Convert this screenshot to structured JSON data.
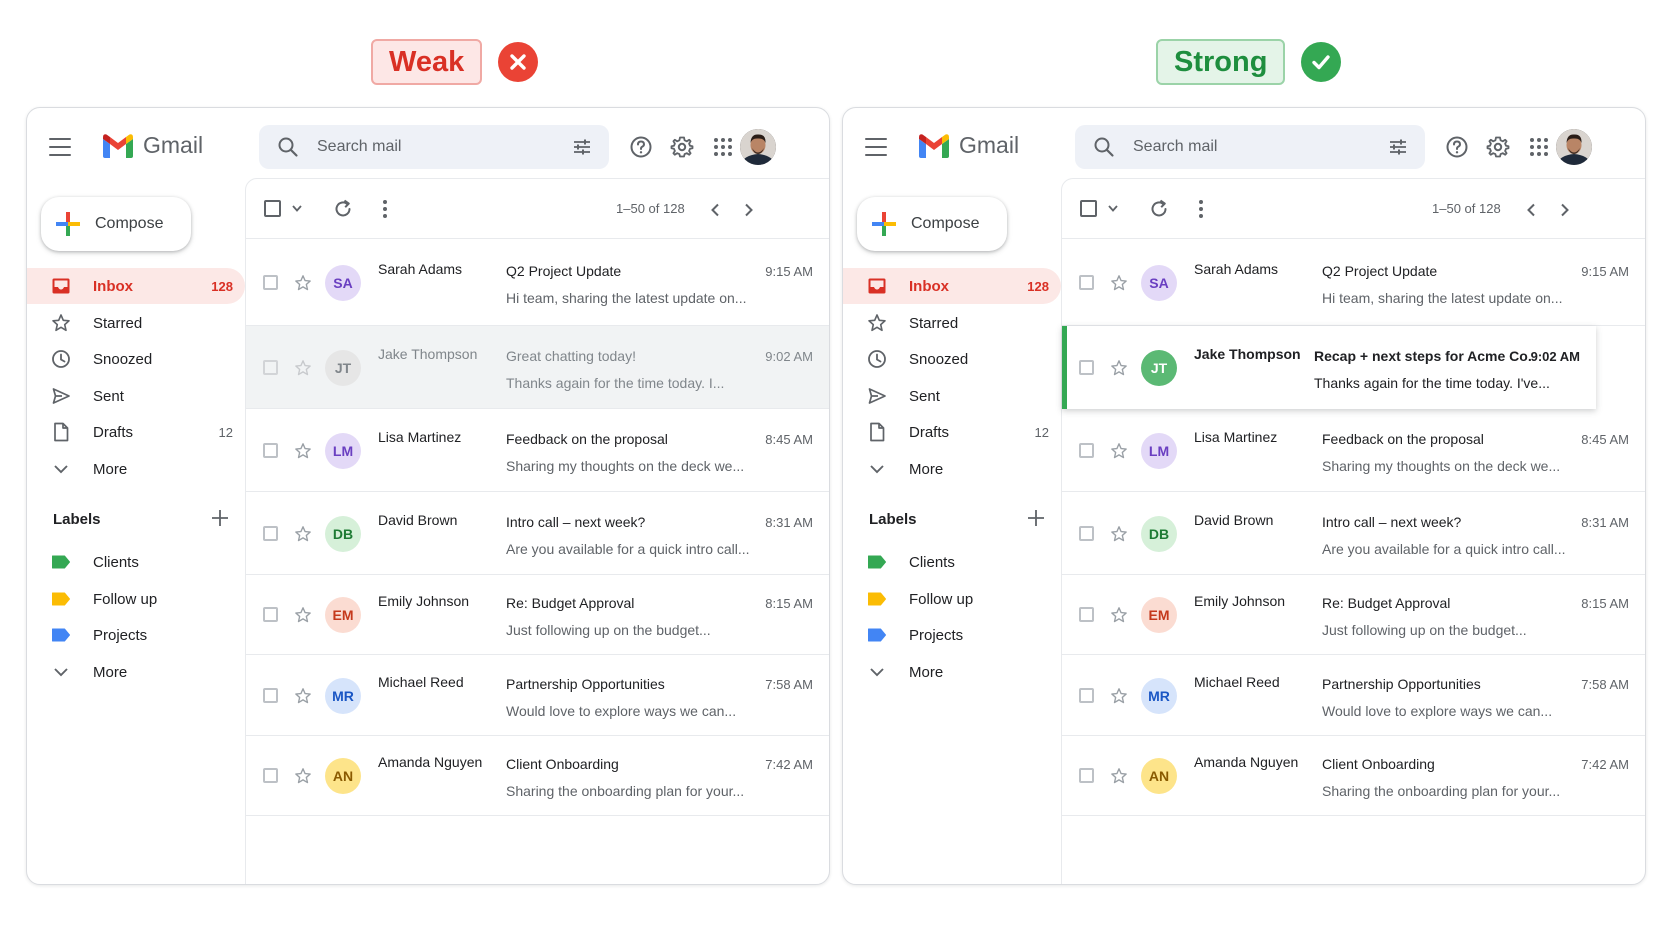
{
  "verdicts": {
    "weak": {
      "label": "Weak",
      "color": "#d93025"
    },
    "strong": {
      "label": "Strong",
      "color": "#1e8e3e"
    }
  },
  "app": {
    "name": "Gmail",
    "search_placeholder": "Search mail",
    "compose_label": "Compose",
    "pager": "1–50 of 128",
    "accent": "#d93025"
  },
  "nav": [
    {
      "label": "Inbox",
      "icon": "inbox-icon",
      "count": "128",
      "active": true
    },
    {
      "label": "Starred",
      "icon": "star-icon",
      "count": ""
    },
    {
      "label": "Snoozed",
      "icon": "clock-icon",
      "count": ""
    },
    {
      "label": "Sent",
      "icon": "send-icon",
      "count": ""
    },
    {
      "label": "Drafts",
      "icon": "draft-icon",
      "count": "12"
    },
    {
      "label": "More",
      "icon": "chevron-down-icon",
      "count": ""
    }
  ],
  "labels": {
    "heading": "Labels",
    "items": [
      {
        "label": "Clients",
        "color": "#34a853"
      },
      {
        "label": "Follow up",
        "color": "#fbbc04"
      },
      {
        "label": "Projects",
        "color": "#4285f4"
      }
    ],
    "more": "More"
  },
  "emails_weak": [
    {
      "initials": "SA",
      "sender": "Sarah Adams",
      "subject": "Q2 Project Update",
      "time": "9:15 AM",
      "snippet": "Hi team, sharing the latest update on...",
      "avatar_bg": "#e3d9f7",
      "avatar_fg": "#6a3fc1"
    },
    {
      "initials": "JT",
      "sender": "Jake Thompson",
      "subject": "Great chatting today!",
      "time": "9:02 AM",
      "snippet": "Thanks again for the time today. I...",
      "avatar_bg": "#e6e6e6",
      "avatar_fg": "#80868b"
    },
    {
      "initials": "LM",
      "sender": "Lisa Martinez",
      "subject": "Feedback on the proposal",
      "time": "8:45 AM",
      "snippet": "Sharing my thoughts on the deck we...",
      "avatar_bg": "#e3d9f7",
      "avatar_fg": "#6a3fc1"
    },
    {
      "initials": "DB",
      "sender": "David Brown",
      "subject": "Intro call – next week?",
      "time": "8:31 AM",
      "snippet": "Are you available for a quick intro call...",
      "avatar_bg": "#d6f0d9",
      "avatar_fg": "#1e7b34"
    },
    {
      "initials": "EM",
      "sender": "Emily Johnson",
      "subject": "Re: Budget Approval",
      "time": "8:15 AM",
      "snippet": "Just following up on the budget...",
      "avatar_bg": "#fbdcd2",
      "avatar_fg": "#c5391c"
    },
    {
      "initials": "MR",
      "sender": "Michael Reed",
      "subject": "Partnership Opportunities",
      "time": "7:58 AM",
      "snippet": "Would love to explore ways we can...",
      "avatar_bg": "#d6e4fb",
      "avatar_fg": "#1a56c4"
    },
    {
      "initials": "AN",
      "sender": "Amanda Nguyen",
      "subject": "Client Onboarding",
      "time": "7:42 AM",
      "snippet": "Sharing the onboarding plan for your...",
      "avatar_bg": "#fde48a",
      "avatar_fg": "#8a5a00"
    }
  ],
  "emails_strong": [
    {
      "initials": "SA",
      "sender": "Sarah Adams",
      "subject": "Q2 Project Update",
      "time": "9:15 AM",
      "snippet": "Hi team, sharing the latest update on...",
      "avatar_bg": "#e3d9f7",
      "avatar_fg": "#6a3fc1"
    },
    {
      "initials": "JT",
      "sender": "Jake Thompson",
      "subject": "Recap + next steps for Acme Co.",
      "time": "9:02 AM",
      "snippet": "Thanks again for the time today. I've...",
      "avatar_bg": "#5bb974",
      "avatar_fg": "#0d4f22"
    },
    {
      "initials": "LM",
      "sender": "Lisa Martinez",
      "subject": "Feedback on the proposal",
      "time": "8:45 AM",
      "snippet": "Sharing my thoughts on the deck we...",
      "avatar_bg": "#e3d9f7",
      "avatar_fg": "#6a3fc1"
    },
    {
      "initials": "DB",
      "sender": "David Brown",
      "subject": "Intro call – next week?",
      "time": "8:31 AM",
      "snippet": "Are you available for a quick intro call...",
      "avatar_bg": "#d6f0d9",
      "avatar_fg": "#1e7b34"
    },
    {
      "initials": "EM",
      "sender": "Emily Johnson",
      "subject": "Re: Budget Approval",
      "time": "8:15 AM",
      "snippet": "Just following up on the budget...",
      "avatar_bg": "#fbdcd2",
      "avatar_fg": "#c5391c"
    },
    {
      "initials": "MR",
      "sender": "Michael Reed",
      "subject": "Partnership Opportunities",
      "time": "7:58 AM",
      "snippet": "Would love to explore ways we can...",
      "avatar_bg": "#d6e4fb",
      "avatar_fg": "#1a56c4"
    },
    {
      "initials": "AN",
      "sender": "Amanda Nguyen",
      "subject": "Client Onboarding",
      "time": "7:42 AM",
      "snippet": "Sharing the onboarding plan for your...",
      "avatar_bg": "#fde48a",
      "avatar_fg": "#8a5a00"
    }
  ]
}
